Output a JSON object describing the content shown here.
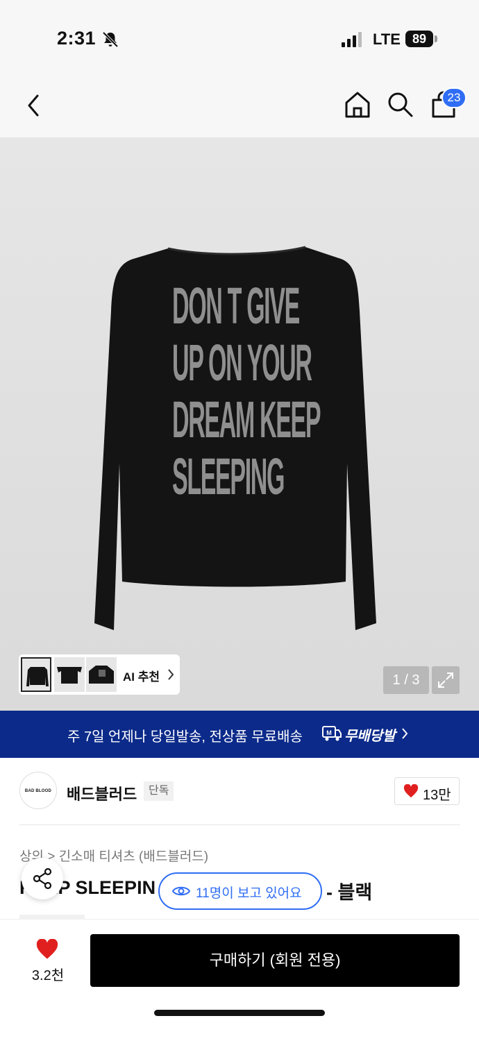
{
  "status_bar": {
    "time": "2:31",
    "network": "LTE",
    "battery": "89"
  },
  "nav": {
    "cart_count": "23"
  },
  "product_image": {
    "shirt_print": [
      "DON T GIVE",
      "UP ON YOUR",
      "DREAM KEEP",
      "SLEEPING"
    ],
    "ai_recommend_label": "AI 추천",
    "page_counter": "1 / 3"
  },
  "promo_banner": {
    "text": "주 7일 언제나 당일발송, 전상품 무료배송",
    "brand": "무배당발"
  },
  "brand": {
    "logo_text": "BAD BLOOD",
    "name": "배드블러드",
    "tag": "단독",
    "likes": "13만"
  },
  "breadcrumb": "상의 > 긴소매 티셔츠 (배드블러드)",
  "product_title": "KEEP SLEEPIN",
  "product_title_suffix": "- 블랙",
  "viewers": "11명이 보고 있어요",
  "bottom_bar": {
    "wish_count": "3.2천",
    "buy_label": "구매하기 (회원 전용)"
  },
  "colors": {
    "accent_blue": "#2f6df4",
    "banner_navy": "#0b2a8a",
    "heart_red": "#e0201f",
    "buy_black": "#000000"
  },
  "icons": [
    "back-icon",
    "home-icon",
    "search-icon",
    "cart-icon",
    "expand-icon",
    "share-icon",
    "eye-icon",
    "heart-icon",
    "bell-off-icon",
    "signal-icon",
    "delivery-truck-icon"
  ]
}
